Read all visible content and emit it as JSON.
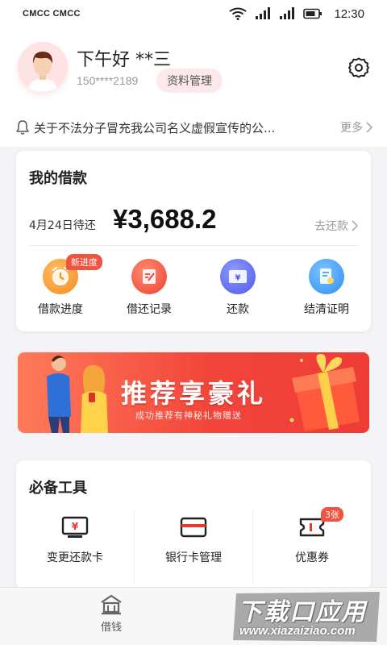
{
  "status_bar": {
    "carrier": "CMCC CMCC",
    "time": "12:30"
  },
  "header": {
    "greeting": "下午好 **三",
    "phone": "150****2189",
    "profile_button": "资料管理"
  },
  "notice": {
    "text": "关于不法分子冒充我公司名义虚假宣传的公...",
    "more": "更多"
  },
  "loan": {
    "title": "我的借款",
    "due_label": "4月24日待还",
    "amount": "¥3,688.2",
    "repay_link": "去还款",
    "actions": [
      {
        "label": "借款进度",
        "icon": "clock-icon",
        "color": "#f79a2a",
        "badge": "新进度"
      },
      {
        "label": "借还记录",
        "icon": "record-icon",
        "color": "#f0543f"
      },
      {
        "label": "还款",
        "icon": "yuan-card-icon",
        "color": "#5d6bec"
      },
      {
        "label": "结清证明",
        "icon": "certificate-icon",
        "color": "#3d9bf0"
      }
    ]
  },
  "banner": {
    "title": "推荐享豪礼",
    "subtitle": "成功推荐有神秘礼物赠送"
  },
  "tools": {
    "title": "必备工具",
    "items": [
      {
        "label": "变更还款卡",
        "icon": "yuan-card-icon"
      },
      {
        "label": "银行卡管理",
        "icon": "bank-card-icon"
      },
      {
        "label": "优惠券",
        "icon": "coupon-icon",
        "badge": "3张"
      }
    ]
  },
  "tabbar": {
    "borrow_label": "借钱"
  },
  "watermark": {
    "cn": "下载口应用",
    "url": "www.xiazaiziao.com"
  },
  "colors": {
    "accent": "#f05340",
    "primary_text": "#222222",
    "secondary_text": "#999999"
  }
}
